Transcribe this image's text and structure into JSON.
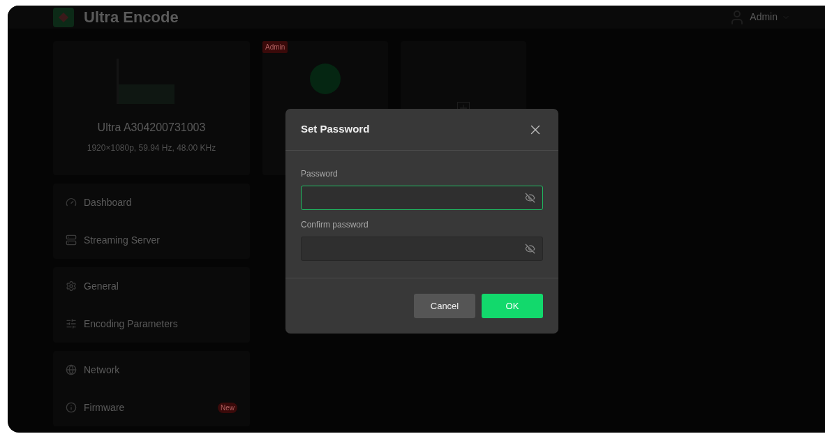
{
  "app": {
    "title": "Ultra Encode",
    "user": "Admin"
  },
  "device": {
    "name": "Ultra A304200731003",
    "signal": "1920×1080p, 59.94 Hz, 48.00 KHz"
  },
  "menu_groups": [
    [
      {
        "label": "Dashboard"
      },
      {
        "label": "Streaming Server"
      }
    ],
    [
      {
        "label": "General"
      },
      {
        "label": "Encoding Parameters"
      }
    ],
    [
      {
        "label": "Network"
      },
      {
        "label": "Firmware",
        "badge": "New"
      }
    ]
  ],
  "user_cards": [
    {
      "badge": "Admin"
    }
  ],
  "dialog": {
    "title": "Set Password",
    "fields": [
      {
        "label": "Password",
        "focused": true
      },
      {
        "label": "Confirm password",
        "focused": false
      }
    ],
    "buttons": [
      {
        "label": "Cancel",
        "kind": "secondary"
      },
      {
        "label": "OK",
        "kind": "primary"
      }
    ]
  }
}
